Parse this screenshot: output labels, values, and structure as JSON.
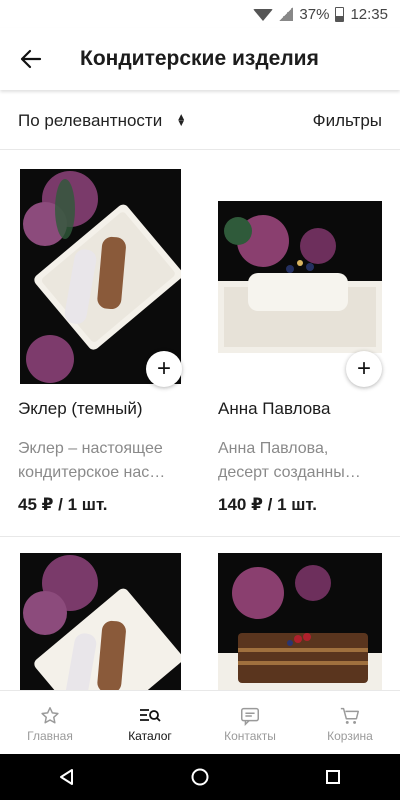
{
  "status_bar": {
    "battery": "37%",
    "time": "12:35"
  },
  "header": {
    "title": "Кондитерские изделия"
  },
  "sort": {
    "label": "По релевантности",
    "filter_label": "Фильтры"
  },
  "products": [
    {
      "name": "Эклер (темный)",
      "desc_line1": "Эклер – настоящее",
      "desc_line2": "кондитерское нас…",
      "price": "45 ₽ / 1 шт."
    },
    {
      "name": "Анна Павлова",
      "desc_line1": "Анна Павлова,",
      "desc_line2": "десерт созданны…",
      "price": "140 ₽ / 1 шт."
    }
  ],
  "nav": {
    "items": [
      {
        "label": "Главная",
        "icon": "star-icon"
      },
      {
        "label": "Каталог",
        "icon": "catalog-search-icon"
      },
      {
        "label": "Контакты",
        "icon": "chat-icon"
      },
      {
        "label": "Корзина",
        "icon": "cart-icon"
      }
    ]
  }
}
